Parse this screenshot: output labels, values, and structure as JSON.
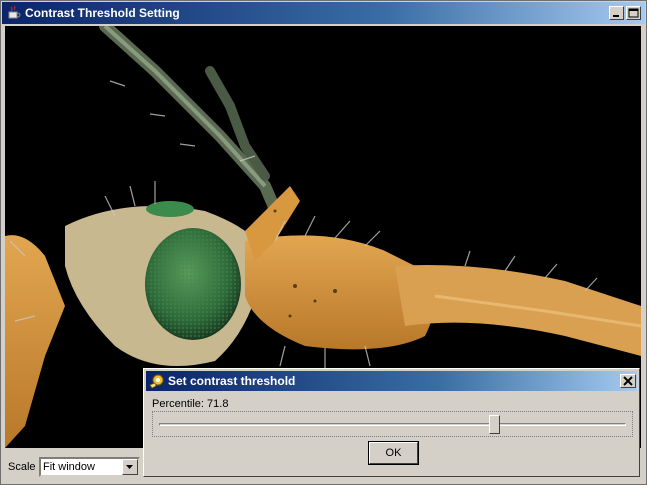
{
  "window": {
    "title": "Contrast Threshold Setting",
    "icon": "java-cup-icon"
  },
  "toolbar": {
    "scale_label": "Scale",
    "scale_value": "Fit window"
  },
  "image": {
    "description_icon": "insect-macro-image"
  },
  "dialog": {
    "title": "Set contrast threshold",
    "icon": "gear-hand-icon",
    "percentile_label": "Percentile: 71.8",
    "percentile_value": 71.8,
    "ok_label": "OK"
  },
  "colors": {
    "title_bar_start": "#0a246a",
    "title_bar_end": "#a6caf0",
    "face": "#d4d0c8"
  }
}
